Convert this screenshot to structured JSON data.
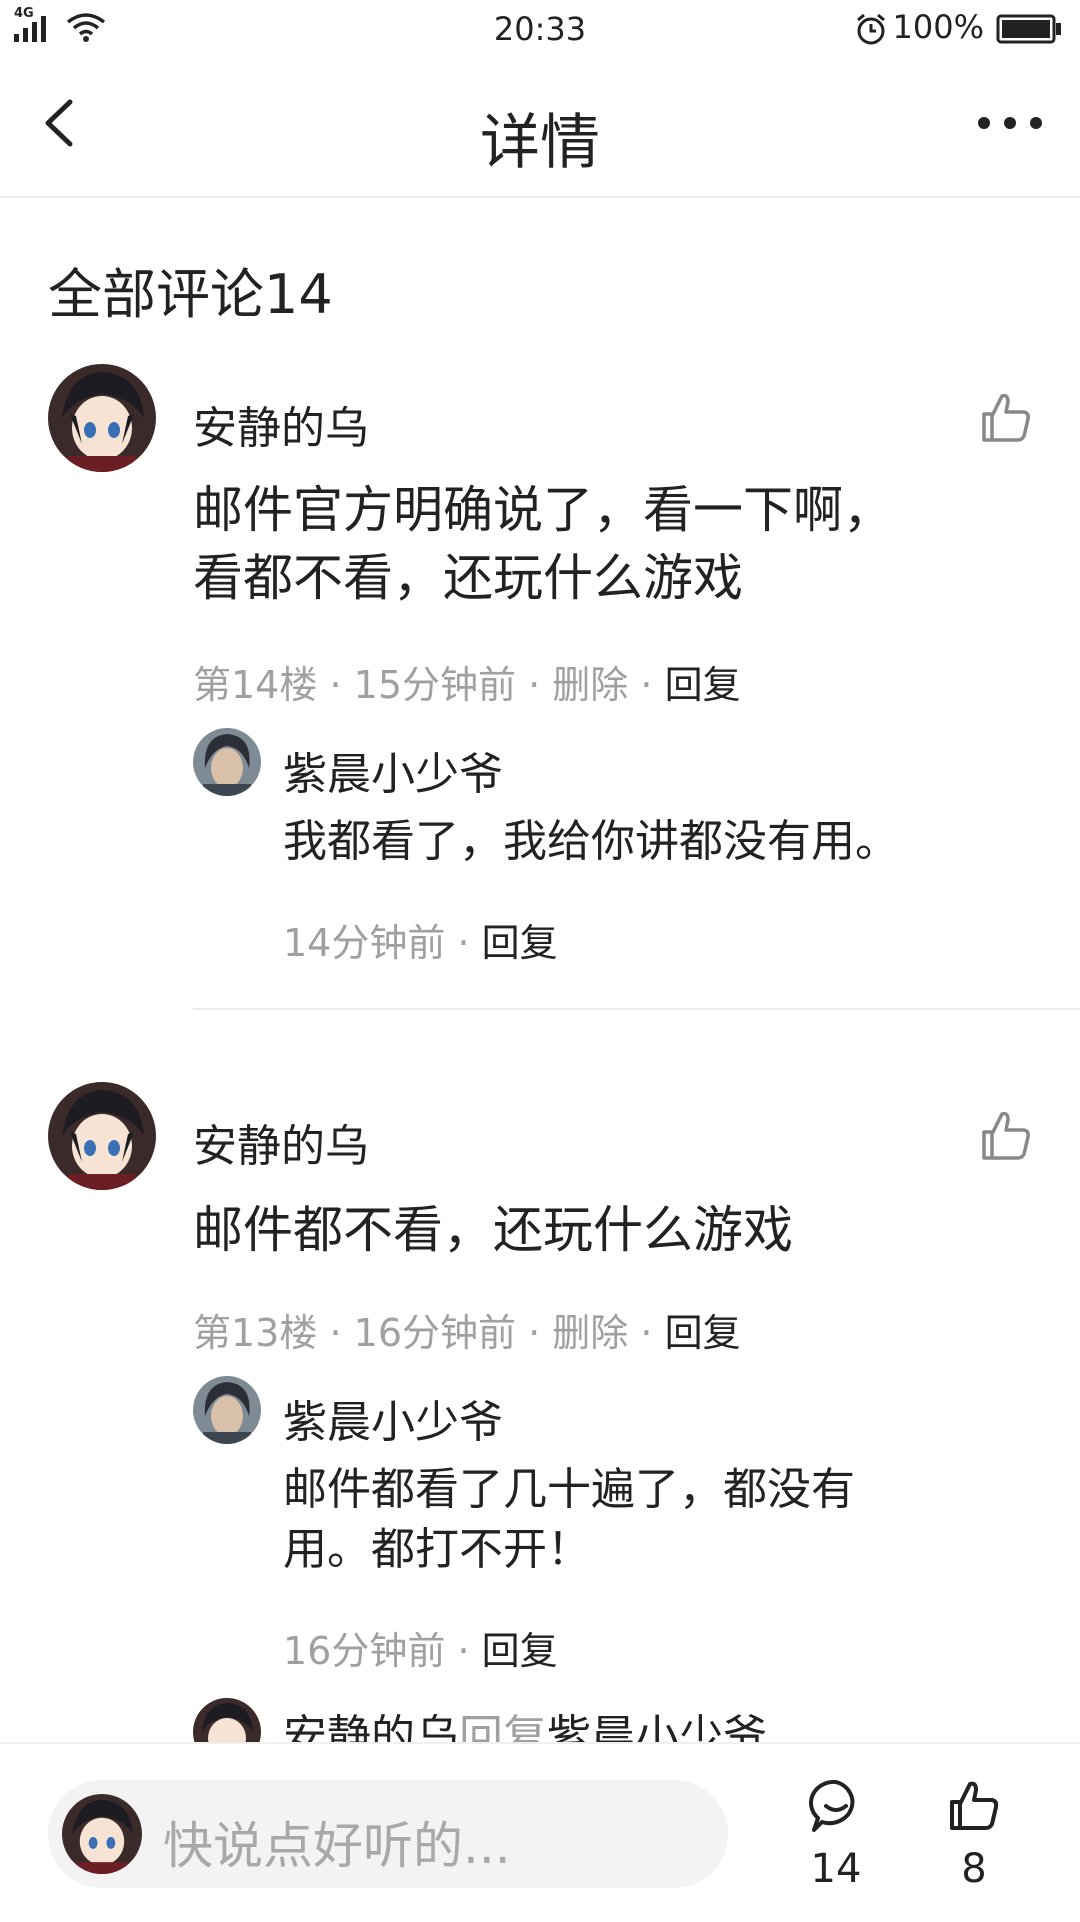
{
  "status_bar": {
    "network": "4G",
    "time": "20:33",
    "battery": "100%"
  },
  "header": {
    "title": "详情"
  },
  "comments_section": {
    "title": "全部评论14"
  },
  "comments": [
    {
      "username": "安静的乌",
      "text_lines": [
        "邮件官方明确说了，看一下啊，",
        "看都不看，还玩什么游戏"
      ],
      "floor": "第14楼",
      "time": "15分钟前",
      "delete_label": "删除",
      "reply_label": "回复",
      "reply": {
        "username": "紫晨小少爷",
        "text_lines": [
          "我都看了，我给你讲都没有用。"
        ],
        "time": "14分钟前",
        "reply_label": "回复"
      }
    },
    {
      "username": "安静的乌",
      "text_lines": [
        "邮件都不看，还玩什么游戏"
      ],
      "floor": "第13楼",
      "time": "16分钟前",
      "delete_label": "删除",
      "reply_label": "回复",
      "reply": {
        "username": "紫晨小少爷",
        "text_lines": [
          "邮件都看了几十遍了，都没有",
          "用。都打不开！"
        ],
        "time": "16分钟前",
        "reply_label": "回复"
      }
    }
  ],
  "partial_reply": {
    "from": "安静的乌",
    "verb": "回复",
    "to": "紫晨小少爷"
  },
  "bottom_bar": {
    "input_placeholder": "快说点好听的...",
    "comment_count": "14",
    "like_count": "8"
  },
  "separator": "·",
  "colors": {
    "text": "#222222",
    "meta_gray": "#a0a0a0",
    "divider": "#ececec",
    "input_bg": "#f3f3f3"
  }
}
